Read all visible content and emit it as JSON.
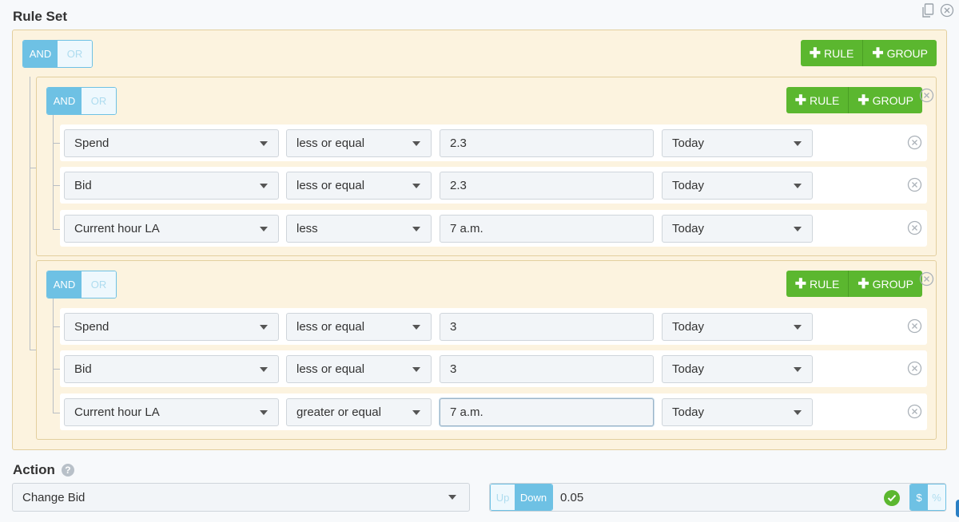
{
  "header": {
    "title": "Rule Set",
    "copy_icon": "copy-icon",
    "close_icon": "close-circle-icon"
  },
  "root_group": {
    "logic": {
      "and": "AND",
      "or": "OR",
      "selected": "AND"
    },
    "add_rule_label": "RULE",
    "add_group_label": "GROUP",
    "groups": [
      {
        "logic": {
          "and": "AND",
          "or": "OR",
          "selected": "AND"
        },
        "add_rule_label": "RULE",
        "add_group_label": "GROUP",
        "rules": [
          {
            "field": "Spend",
            "operator": "less or equal",
            "value": "2.3",
            "period": "Today"
          },
          {
            "field": "Bid",
            "operator": "less or equal",
            "value": "2.3",
            "period": "Today"
          },
          {
            "field": "Current hour LA",
            "operator": "less",
            "value": "7 a.m.",
            "period": "Today"
          }
        ]
      },
      {
        "logic": {
          "and": "AND",
          "or": "OR",
          "selected": "AND"
        },
        "add_rule_label": "RULE",
        "add_group_label": "GROUP",
        "rules": [
          {
            "field": "Spend",
            "operator": "less or equal",
            "value": "3",
            "period": "Today"
          },
          {
            "field": "Bid",
            "operator": "less or equal",
            "value": "3",
            "period": "Today"
          },
          {
            "field": "Current hour LA",
            "operator": "greater or equal",
            "value": "7 a.m.",
            "period": "Today"
          }
        ]
      }
    ]
  },
  "action": {
    "label": "Action",
    "help_icon": "?",
    "selected": "Change Bid",
    "direction": {
      "up": "Up",
      "down": "Down",
      "selected": "Down"
    },
    "amount": "0.05",
    "unit": {
      "dollar": "$",
      "percent": "%",
      "selected": "$"
    }
  },
  "colors": {
    "accent": "#6ec1e4",
    "add_button": "#5bb72f",
    "group_bg": "#fcf3df"
  }
}
